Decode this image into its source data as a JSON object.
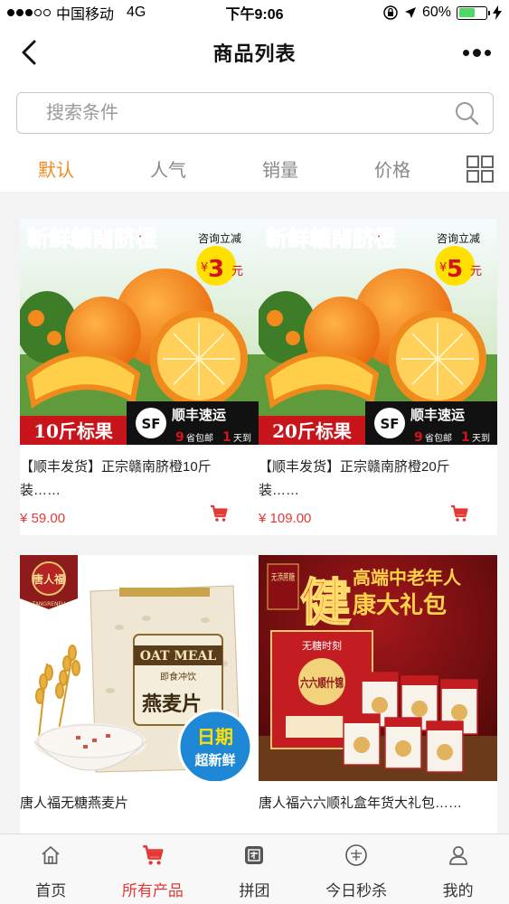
{
  "status_bar": {
    "carrier": "中国移动",
    "network": "4G",
    "time": "下午9:06",
    "battery_percent": "60%",
    "battery_level": 0.6
  },
  "nav": {
    "title": "商品列表"
  },
  "search": {
    "placeholder": "搜索条件"
  },
  "sort_tabs": [
    {
      "label": "默认",
      "active": true
    },
    {
      "label": "人气",
      "active": false
    },
    {
      "label": "销量",
      "active": false
    },
    {
      "label": "价格",
      "active": false
    }
  ],
  "products": [
    {
      "title": "【顺丰发货】正宗赣南脐橙10斤装……",
      "price": "¥ 59.00",
      "image": {
        "headline": "新鲜赣南脐橙",
        "badge_top": "咨询立减",
        "badge_value": "3",
        "badge_unit": "元",
        "weight_label": "10斤标果",
        "courier": "顺丰速运",
        "courier_logo": "SF",
        "shipping_note_a": "9",
        "shipping_note_b": "省包邮",
        "shipping_note_c": "1",
        "shipping_note_d": "天到"
      }
    },
    {
      "title": "【顺丰发货】正宗赣南脐橙20斤装……",
      "price": "¥ 109.00",
      "image": {
        "headline": "新鲜赣南脐橙",
        "badge_top": "咨询立减",
        "badge_value": "5",
        "badge_unit": "元",
        "weight_label": "20斤标果",
        "courier": "顺丰速运",
        "courier_logo": "SF",
        "shipping_note_a": "9",
        "shipping_note_b": "省包邮",
        "shipping_note_c": "1",
        "shipping_note_d": "天到"
      }
    },
    {
      "title": "唐人福无糖燕麦片",
      "image": {
        "brand": "唐人福",
        "brand_en": "TANGRENFU",
        "pack_text": "OAT MEAL",
        "pack_sub": "即食冲饮",
        "pack_cn": "燕麦片",
        "burst_line1": "日期",
        "burst_line2": "超新鲜"
      }
    },
    {
      "title": "唐人福六六顺礼盒年货大礼包……",
      "image": {
        "side_tag": "无添蔗糖",
        "big_char": "健",
        "line1": "高端中老年人",
        "line2": "康大礼包",
        "box_brand": "无糖时刻",
        "box_title": "六六顺什锦"
      }
    }
  ],
  "tab_bar": [
    {
      "label": "首页",
      "icon": "home-icon",
      "active": false
    },
    {
      "label": "所有产品",
      "icon": "cart-icon",
      "active": true
    },
    {
      "label": "拼团",
      "icon": "group-icon",
      "active": false
    },
    {
      "label": "今日秒杀",
      "icon": "flash-sale-icon",
      "active": false
    },
    {
      "label": "我的",
      "icon": "user-icon",
      "active": false
    }
  ],
  "colors": {
    "accent_orange": "#f08a23",
    "price_red": "#e53935",
    "list_background": "#f3f3f3"
  }
}
